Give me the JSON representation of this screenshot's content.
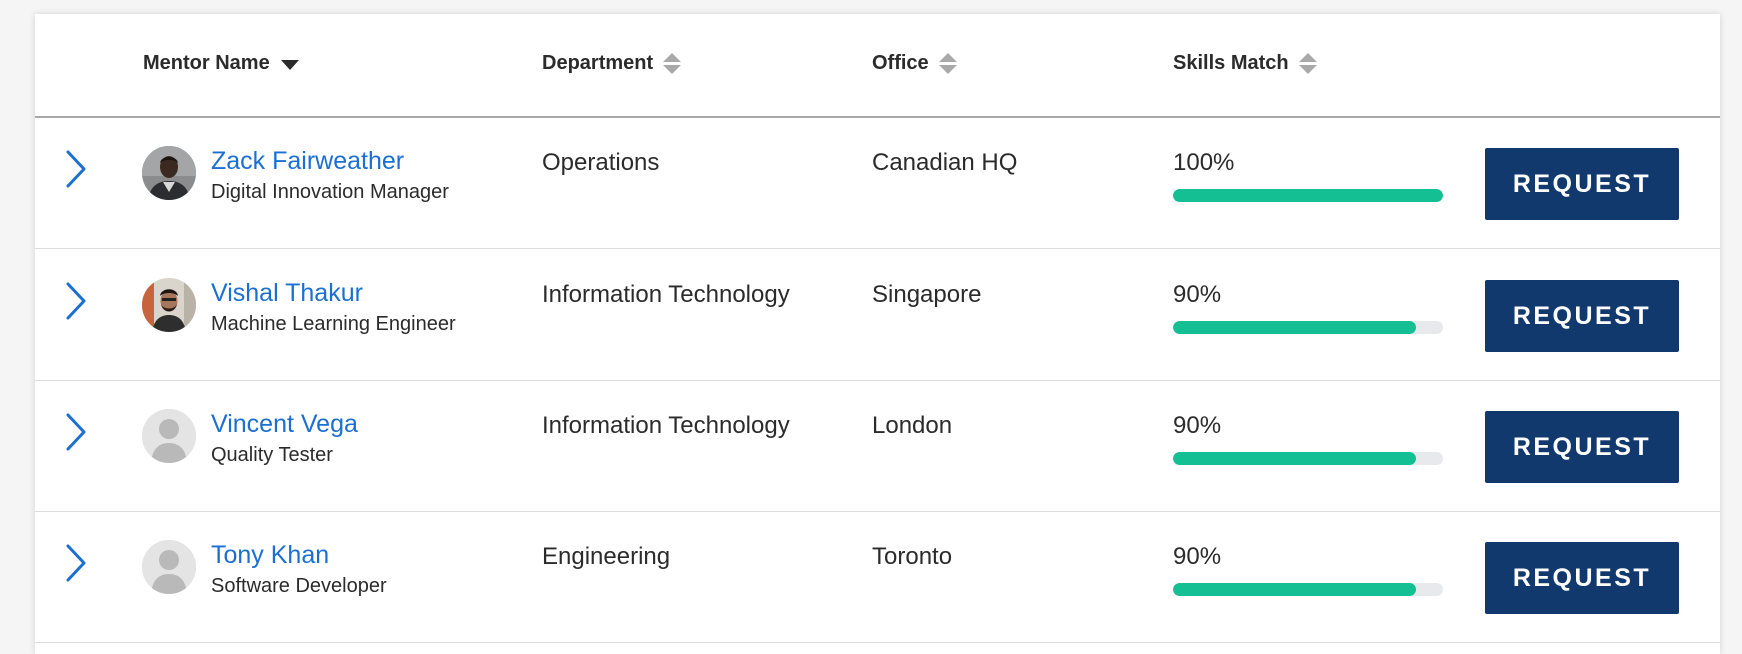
{
  "table": {
    "columns": {
      "mentor_name": "Mentor Name",
      "department": "Department",
      "office": "Office",
      "skills_match": "Skills Match"
    },
    "rows": [
      {
        "name": "Zack Fairweather",
        "title": "Digital Innovation Manager",
        "department": "Operations",
        "office": "Canadian HQ",
        "skills_match": "100%",
        "skills_match_fraction": 1.0,
        "avatar": "photo-man-dark-jacket",
        "action_label": "REQUEST"
      },
      {
        "name": "Vishal Thakur",
        "title": "Machine Learning Engineer",
        "department": "Information Technology",
        "office": "Singapore",
        "skills_match": "90%",
        "skills_match_fraction": 0.9,
        "avatar": "photo-man-bearded",
        "action_label": "REQUEST"
      },
      {
        "name": "Vincent Vega",
        "title": "Quality Tester",
        "department": "Information Technology",
        "office": "London",
        "skills_match": "90%",
        "skills_match_fraction": 0.9,
        "avatar": "default-user-silhouette",
        "action_label": "REQUEST"
      },
      {
        "name": "Tony Khan",
        "title": "Software Developer",
        "department": "Engineering",
        "office": "Toronto",
        "skills_match": "90%",
        "skills_match_fraction": 0.9,
        "avatar": "default-user-silhouette",
        "action_label": "REQUEST"
      }
    ]
  },
  "colors": {
    "link": "#1a6fd1",
    "progress_fill": "#13bf93",
    "progress_track": "#e8e9ec",
    "button_bg": "#12396d",
    "button_text": "#ffffff",
    "expander": "#1a6fd1"
  }
}
